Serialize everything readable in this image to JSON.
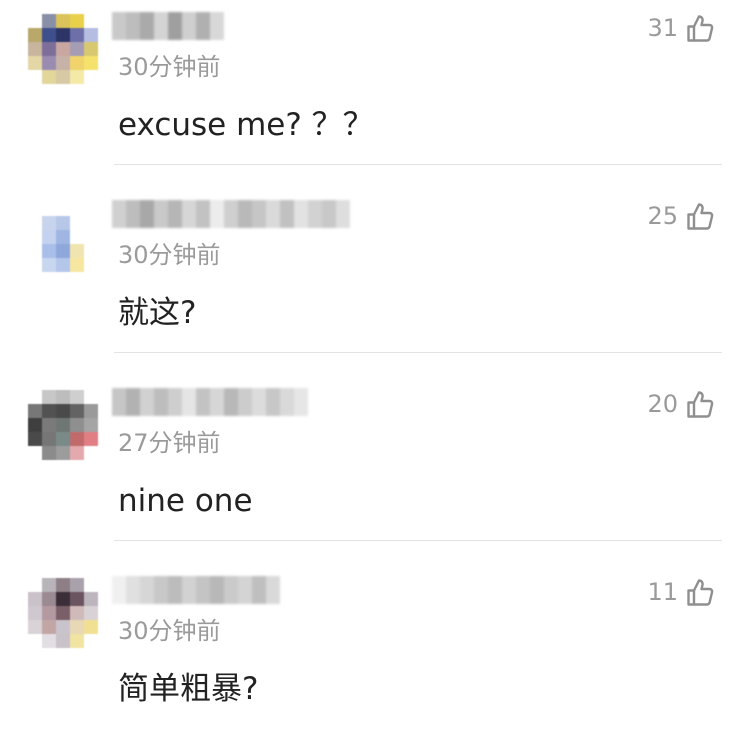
{
  "comments": [
    {
      "time": "30分钟前",
      "text": "excuse me? ？？",
      "likes": "31",
      "avatar_colors": [
        "#ffffff",
        "#8a8fa8",
        "#d9c35a",
        "#e8d04a",
        "#ffffff",
        "#b9a86a",
        "#3e4f8c",
        "#2d3566",
        "#6e6fa9",
        "#b5bde0",
        "#c7b59e",
        "#7d6f9a",
        "#c9a7a0",
        "#a59db3",
        "#d8c86f",
        "#e4d7a6",
        "#9a8cb0",
        "#c7b2a7",
        "#f0d36a",
        "#f4e26d",
        "#ffffff",
        "#e2d69b",
        "#d6c9a4",
        "#f5e9a8",
        "#ffffff"
      ],
      "name_colors": [
        "#c9c9c9",
        "#bdbdbd",
        "#aaaaaa",
        "#d4d4d4",
        "#9f9f9f",
        "#cfcfcf",
        "#b0b0b0",
        "#d8d8d8"
      ]
    },
    {
      "time": "30分钟前",
      "text": "就这?",
      "likes": "25",
      "avatar_colors": [
        "#ffffff",
        "#ffffff",
        "#ffffff",
        "#ffffff",
        "#ffffff",
        "#ffffff",
        "#c8d4ee",
        "#b7c7e8",
        "#ffffff",
        "#ffffff",
        "#ffffff",
        "#c4d2ef",
        "#9fb6e2",
        "#ffffff",
        "#ffffff",
        "#ffffff",
        "#a9bfe9",
        "#8fa8dc",
        "#f0e4b0",
        "#ffffff",
        "#ffffff",
        "#c9d6f0",
        "#b4c6ea",
        "#f6e6a0",
        "#ffffff"
      ],
      "name_colors": [
        "#d0d0d0",
        "#bdbdbd",
        "#a8a8a8",
        "#c9c9c9",
        "#b6b6b6",
        "#d6d6d6",
        "#c2c2c2",
        "#ececec",
        "#cfcfcf",
        "#b9b9b9",
        "#c6c6c6",
        "#dadada",
        "#c1c1c1",
        "#e2e2e2",
        "#d2d2d2",
        "#c8c8c8",
        "#dedede"
      ]
    },
    {
      "time": "27分钟前",
      "text": "nine one",
      "likes": "20",
      "avatar_colors": [
        "#ffffff",
        "#c7c7c7",
        "#bdbdbd",
        "#cfcfcf",
        "#ffffff",
        "#777777",
        "#525252",
        "#4a4a4a",
        "#636363",
        "#9a9a9a",
        "#3f3f3f",
        "#7a7a7a",
        "#6f7775",
        "#8f8f8f",
        "#a5a5a5",
        "#4a4a4a",
        "#767676",
        "#7a8a88",
        "#c06a6c",
        "#e07e84",
        "#ffffff",
        "#8b8b8b",
        "#9c9c9c",
        "#e4a9ac",
        "#ffffff"
      ],
      "name_colors": [
        "#c6c6c6",
        "#b2b2b2",
        "#d1d1d1",
        "#bdbdbd",
        "#cecece",
        "#e5e5e5",
        "#c3c3c3",
        "#d6d6d6",
        "#b8b8b8",
        "#cccccc",
        "#dcdcdc",
        "#c7c7c7",
        "#d9d9d9",
        "#e6e6e6"
      ]
    },
    {
      "time": "30分钟前",
      "text": "简单粗暴?",
      "likes": "11",
      "avatar_colors": [
        "#ffffff",
        "#b9b4b9",
        "#8e7f86",
        "#a9a2ac",
        "#ffffff",
        "#c9c2c8",
        "#9b8a91",
        "#3b2e38",
        "#6a5460",
        "#bdb5bd",
        "#cfc8cf",
        "#b39aa1",
        "#7a5f68",
        "#cfbab9",
        "#d8d2d6",
        "#d9d2d7",
        "#c2a6a6",
        "#c9c4cb",
        "#e8d8b5",
        "#f2e092",
        "#ffffff",
        "#e3dee3",
        "#c9c2c8",
        "#f0e4a0",
        "#ffffff"
      ],
      "name_colors": [
        "#f0f0f0",
        "#e0e0e0",
        "#d6d6d6",
        "#c8c8c8",
        "#bcbcbc",
        "#d2d2d2",
        "#c4c4c4",
        "#b8b8b8",
        "#cacaca",
        "#d4d4d4",
        "#bfbfbf",
        "#d9d9d9"
      ]
    }
  ]
}
